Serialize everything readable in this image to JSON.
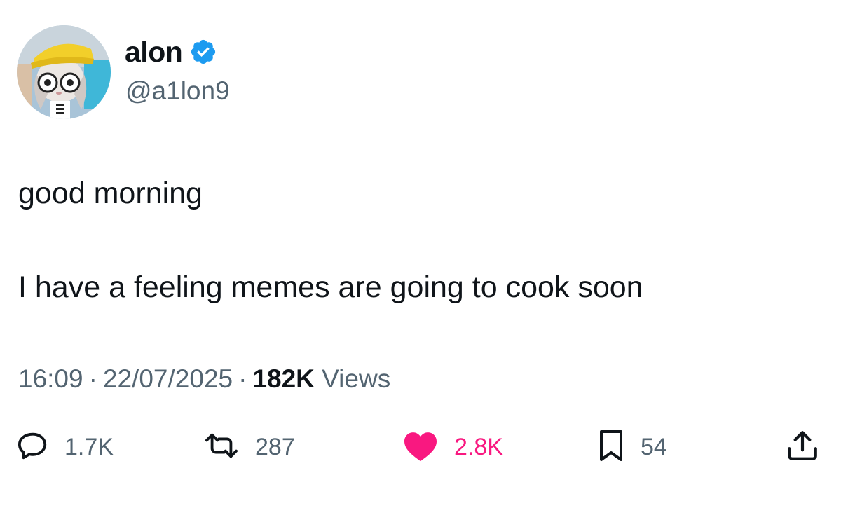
{
  "user": {
    "display_name": "alon",
    "handle": "@a1lon9",
    "verified_icon": "verified-badge-icon"
  },
  "tweet": {
    "lines": [
      "good morning",
      "I have a feeling memes are going to cook soon"
    ]
  },
  "meta": {
    "time": "16:09",
    "separator": "·",
    "date": "22/07/2025",
    "views_count": "182K",
    "views_label": "Views"
  },
  "actions": {
    "reply": {
      "icon": "reply-icon",
      "count": "1.7K"
    },
    "retweet": {
      "icon": "retweet-icon",
      "count": "287"
    },
    "like": {
      "icon": "heart-icon",
      "count": "2.8K",
      "liked": true,
      "color": "#f91880"
    },
    "bookmark": {
      "icon": "bookmark-icon",
      "count": "54"
    },
    "share": {
      "icon": "share-icon"
    }
  },
  "colors": {
    "text_primary": "#0f1419",
    "text_secondary": "#536471",
    "verified_blue": "#1d9bf0",
    "like_pink": "#f91880"
  }
}
